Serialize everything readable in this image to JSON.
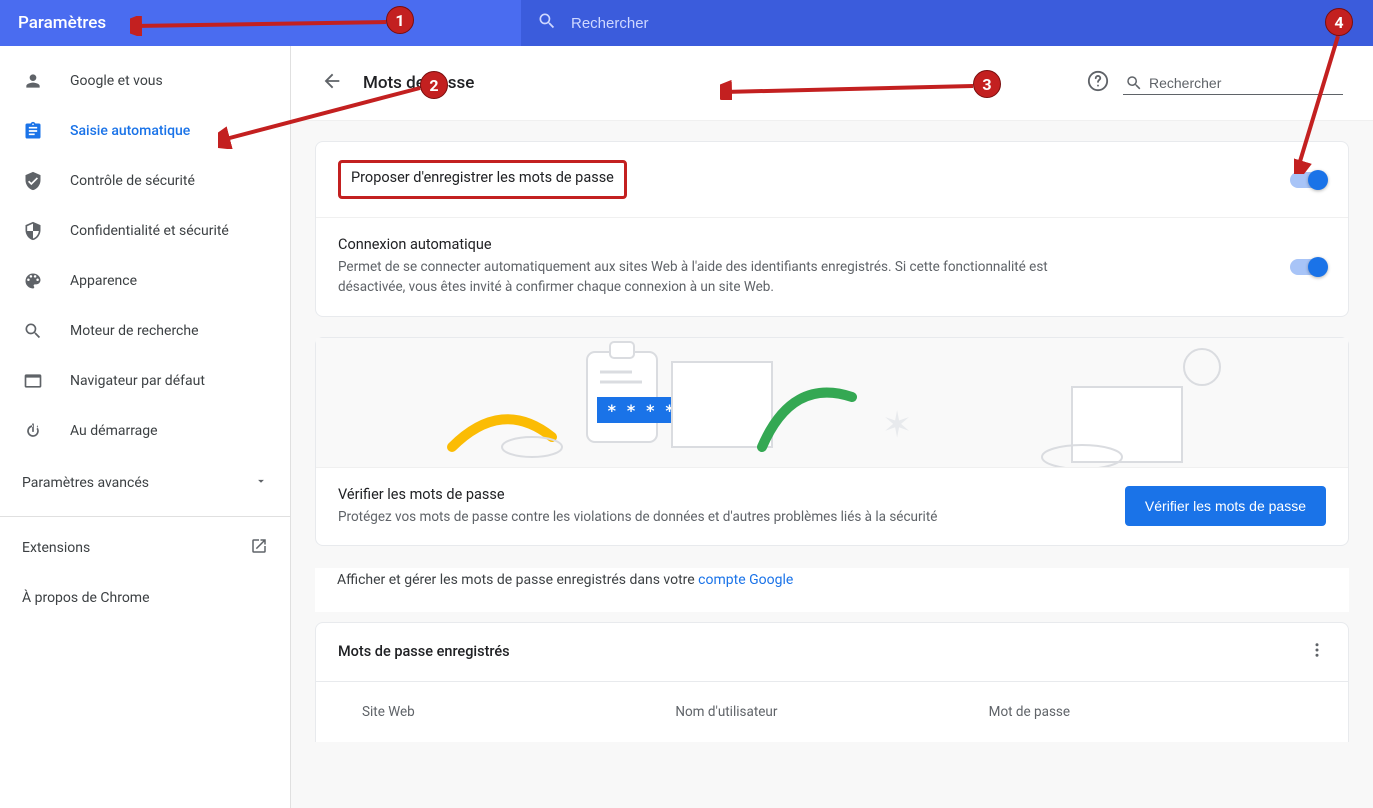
{
  "header": {
    "app_title": "Paramètres",
    "search_placeholder": "Rechercher"
  },
  "sidebar": {
    "items": [
      {
        "label": "Google et vous"
      },
      {
        "label": "Saisie automatique"
      },
      {
        "label": "Contrôle de sécurité"
      },
      {
        "label": "Confidentialité et sécurité"
      },
      {
        "label": "Apparence"
      },
      {
        "label": "Moteur de recherche"
      },
      {
        "label": "Navigateur par défaut"
      },
      {
        "label": "Au démarrage"
      }
    ],
    "advanced_label": "Paramètres avancés",
    "extensions_label": "Extensions",
    "about_label": "À propos de Chrome"
  },
  "page": {
    "title": "Mots de passe",
    "search_placeholder": "Rechercher"
  },
  "settings": {
    "offer_save": {
      "title": "Proposer d'enregistrer les mots de passe"
    },
    "auto_signin": {
      "title": "Connexion automatique",
      "desc": "Permet de se connecter automatiquement aux sites Web à l'aide des identifiants enregistrés. Si cette fonctionnalité est désactivée, vous êtes invité à confirmer chaque connexion à un site Web."
    },
    "verify": {
      "title": "Vérifier les mots de passe",
      "desc": "Protégez vos mots de passe contre les violations de données et d'autres problèmes liés à la sécurité",
      "button": "Vérifier les mots de passe"
    },
    "manage_text": "Afficher et gérer les mots de passe enregistrés dans votre ",
    "manage_link": "compte Google",
    "saved_title": "Mots de passe enregistrés",
    "columns": {
      "site": "Site Web",
      "user": "Nom d'utilisateur",
      "pass": "Mot de passe"
    }
  },
  "illustration_placeholder": "****",
  "annotations": {
    "m1": "1",
    "m2": "2",
    "m3": "3",
    "m4": "4"
  }
}
